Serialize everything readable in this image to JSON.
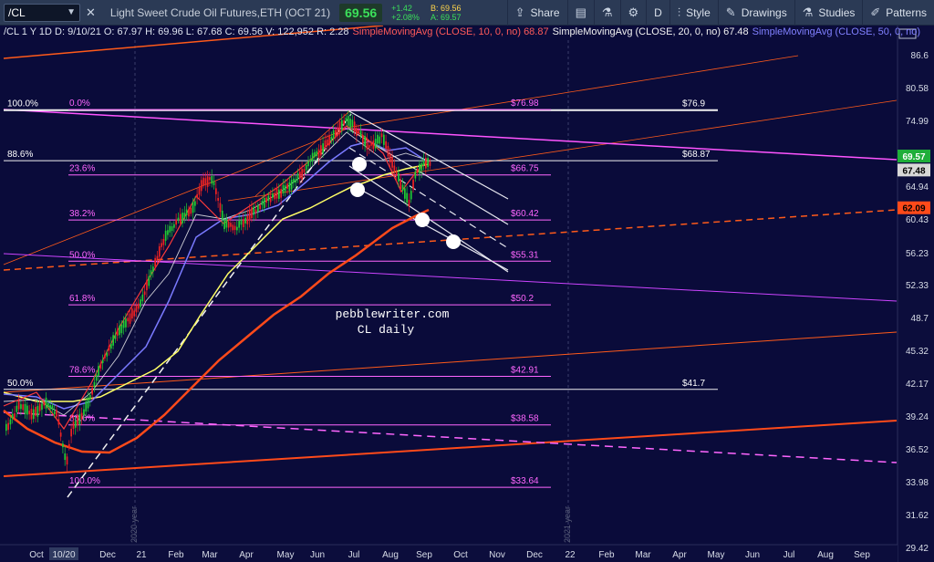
{
  "toolbar": {
    "symbol": "/CL",
    "description": "Light Sweet Crude Oil Futures,ETH (OCT 21)",
    "last": "69.56",
    "change": "+1.42",
    "change_pct": "+2.08%",
    "bid": "B: 69.56",
    "ask": "A: 69.57",
    "share_label": "Share",
    "interval_label": "D",
    "style_label": "Style",
    "drawings_label": "Drawings",
    "studies_label": "Studies",
    "patterns_label": "Patterns"
  },
  "legend": {
    "ohlc": "/CL 1 Y 1D  D: 9/10/21  O: 67.97  H: 69.96  L: 67.68  C: 69.56  V: 122,952  R: 2.28",
    "sma10": "SimpleMovingAvg (CLOSE, 10, 0, no)",
    "sma10_value": "68.87",
    "sma20": "SimpleMovingAvg (CLOSE, 20, 0, no)",
    "sma20_value": "67.48",
    "sma50": "SimpleMovingAvg (CLOSE, 50, 0, no)"
  },
  "watermark": {
    "line1": "pebblewriter.com",
    "line2": "CL daily"
  },
  "colors": {
    "background": "#0a0b3a",
    "fib": "#ff66ff",
    "sma10": "#ff3a3a",
    "sma20": "#f0f0f0",
    "sma50": "#7a7aff",
    "sma200": "#ff4a1a",
    "yellow_ma": "#ffff66",
    "up_candle": "#22cc33",
    "down_candle": "#ee2222",
    "last_badge": "#1fae3a",
    "sma20_badge": "#d8d8d8",
    "level_badge": "#ff4a1a"
  },
  "chart_data": {
    "type": "candlestick",
    "title": "",
    "y_axis": {
      "min": 30,
      "max": 89,
      "ticks": [
        "86.6",
        "80.58",
        "74.99",
        "69.57",
        "64.94",
        "60.43",
        "56.23",
        "52.33",
        "48.7",
        "45.32",
        "42.17",
        "39.24",
        "36.52",
        "33.98",
        "31.62",
        "29.42"
      ]
    },
    "x_axis": {
      "labels": [
        "Oct",
        "10/20",
        "Dec",
        "21",
        "Feb",
        "Mar",
        "Apr",
        "May",
        "Jun",
        "Jul",
        "Aug",
        "Sep",
        "Oct",
        "Nov",
        "Dec",
        "22",
        "Feb",
        "Mar",
        "Apr",
        "May",
        "Jun",
        "Jul",
        "Aug",
        "Sep"
      ]
    },
    "year_markers": [
      "2020 year",
      "2021 year"
    ],
    "fib_retracement_1": {
      "levels": [
        {
          "label": "100.0%",
          "value": 76.9
        },
        {
          "label": "88.6%",
          "value": 68.87
        },
        {
          "label": "50.0%",
          "value": 41.7
        }
      ],
      "price_labels": [
        "$76.9",
        "$68.87",
        "$41.7"
      ]
    },
    "fib_retracement_2": {
      "levels": [
        {
          "label": "0.0%",
          "value": 76.98,
          "price": "$76.98"
        },
        {
          "label": "23.6%",
          "value": 66.75,
          "price": "$66.75"
        },
        {
          "label": "38.2%",
          "value": 60.42,
          "price": "$60.42"
        },
        {
          "label": "50.0%",
          "value": 55.31,
          "price": "$55.31"
        },
        {
          "label": "61.8%",
          "value": 50.2,
          "price": "$50.2"
        },
        {
          "label": "78.6%",
          "value": 42.91,
          "price": "$42.91"
        },
        {
          "label": "88.6%",
          "value": 38.58,
          "price": "$38.58"
        },
        {
          "label": "100.0%",
          "value": 33.64,
          "price": "$33.64"
        }
      ]
    },
    "price_badges": [
      {
        "label": "69.57",
        "value": 69.57,
        "kind": "last"
      },
      {
        "label": "67.48",
        "value": 67.48,
        "kind": "sma20"
      },
      {
        "label": "62.09",
        "value": 62.09,
        "kind": "level"
      }
    ]
  }
}
